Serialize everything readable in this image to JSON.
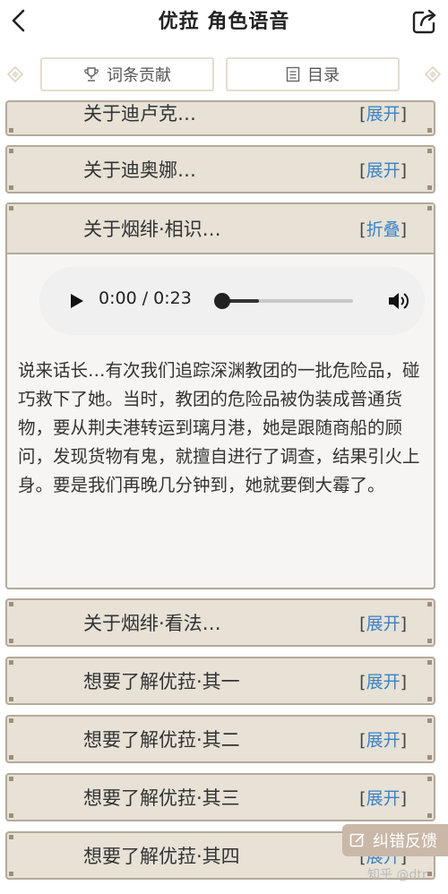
{
  "header": {
    "title": "优菈 角色语音"
  },
  "toolbar": {
    "contribute_label": "词条贡献",
    "toc_label": "目录"
  },
  "sections": [
    {
      "title": "关于迪卢克…",
      "toggle": "展开"
    },
    {
      "title": "关于迪奥娜…",
      "toggle": "展开"
    },
    {
      "title": "关于烟绯·相识…",
      "toggle": "折叠"
    },
    {
      "title": "关于烟绯·看法…",
      "toggle": "展开"
    },
    {
      "title": "想要了解优菈·其一",
      "toggle": "展开"
    },
    {
      "title": "想要了解优菈·其二",
      "toggle": "展开"
    },
    {
      "title": "想要了解优菈·其三",
      "toggle": "展开"
    },
    {
      "title": "想要了解优菈·其四",
      "toggle": "展开"
    }
  ],
  "audio": {
    "time": "0:00 / 0:23",
    "progress": 0.0
  },
  "description": "说来话长…有次我们追踪深渊教团的一批危险品，碰巧救下了她。当时，教团的危险品被伪装成普通货物，要从荆夫港转运到璃月港，她是跟随商船的顾问，发现货物有鬼，就擅自进行了调查，结果引火上身。要是我们再晚几分钟到，她就要倒大霉了。",
  "feedback": {
    "label": "纠错反馈"
  },
  "watermark": "知乎 @dtr",
  "colors": {
    "accent_link": "#3b82c4",
    "section_bg": "#e7e1d6",
    "section_border": "#b5a99a"
  }
}
